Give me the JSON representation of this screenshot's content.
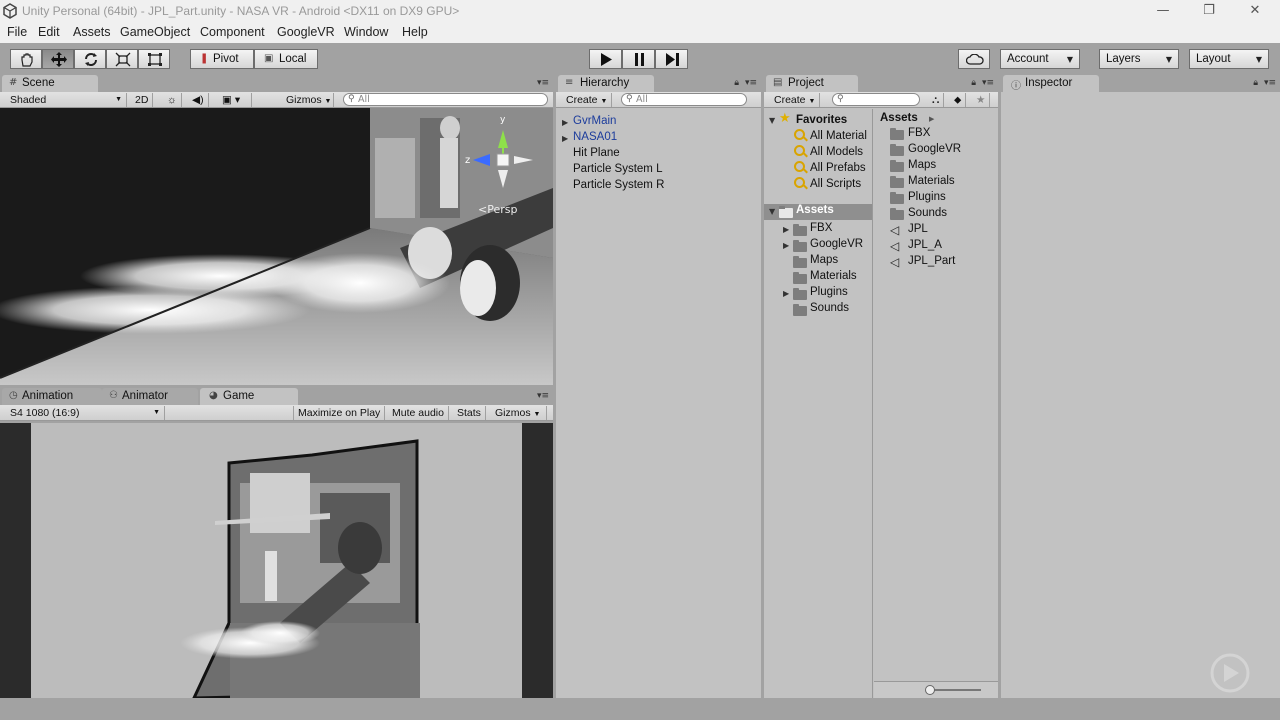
{
  "window": {
    "title": "Unity Personal (64bit) - JPL_Part.unity - NASA VR - Android <DX11 on DX9 GPU>",
    "minimize": "—",
    "restore": "❐",
    "close": "✕"
  },
  "menu": [
    "File",
    "Edit",
    "Assets",
    "GameObject",
    "Component",
    "GoogleVR",
    "Window",
    "Help"
  ],
  "toolbar": {
    "pivot": "Pivot",
    "local": "Local",
    "account": "Account",
    "layers": "Layers",
    "layout": "Layout"
  },
  "scene": {
    "tab": "Scene",
    "shading": "Shaded",
    "mode_2d": "2D",
    "gizmos": "Gizmos",
    "search_placeholder": "All",
    "persp": "Persp",
    "axis_y": "y",
    "axis_z": "z"
  },
  "game": {
    "tabs": [
      "Animation",
      "Animator",
      "Game"
    ],
    "resolution": "S4 1080 (16:9)",
    "maximize": "Maximize on Play",
    "mute": "Mute audio",
    "stats": "Stats",
    "gizmos": "Gizmos"
  },
  "hierarchy": {
    "tab": "Hierarchy",
    "create": "Create",
    "search_placeholder": "All",
    "items": [
      "GvrMain",
      "NASA01",
      "Hit Plane",
      "Particle System L",
      "Particle System R"
    ]
  },
  "project": {
    "tab": "Project",
    "create": "Create",
    "favorites_label": "Favorites",
    "favorites": [
      "All Material",
      "All Models",
      "All Prefabs",
      "All Scripts"
    ],
    "assets_label": "Assets",
    "tree": [
      "FBX",
      "GoogleVR",
      "Maps",
      "Materials",
      "Plugins",
      "Sounds"
    ],
    "breadcrumb": "Assets",
    "folders": [
      "FBX",
      "GoogleVR",
      "Maps",
      "Materials",
      "Plugins",
      "Sounds"
    ],
    "files": [
      "JPL",
      "JPL_A",
      "JPL_Part"
    ]
  },
  "inspector": {
    "tab": "Inspector"
  },
  "colors": {
    "accent_blue": "#3b5bdb",
    "selected_row": "#8f8f8f",
    "panel_bg": "#c2c2c2"
  }
}
